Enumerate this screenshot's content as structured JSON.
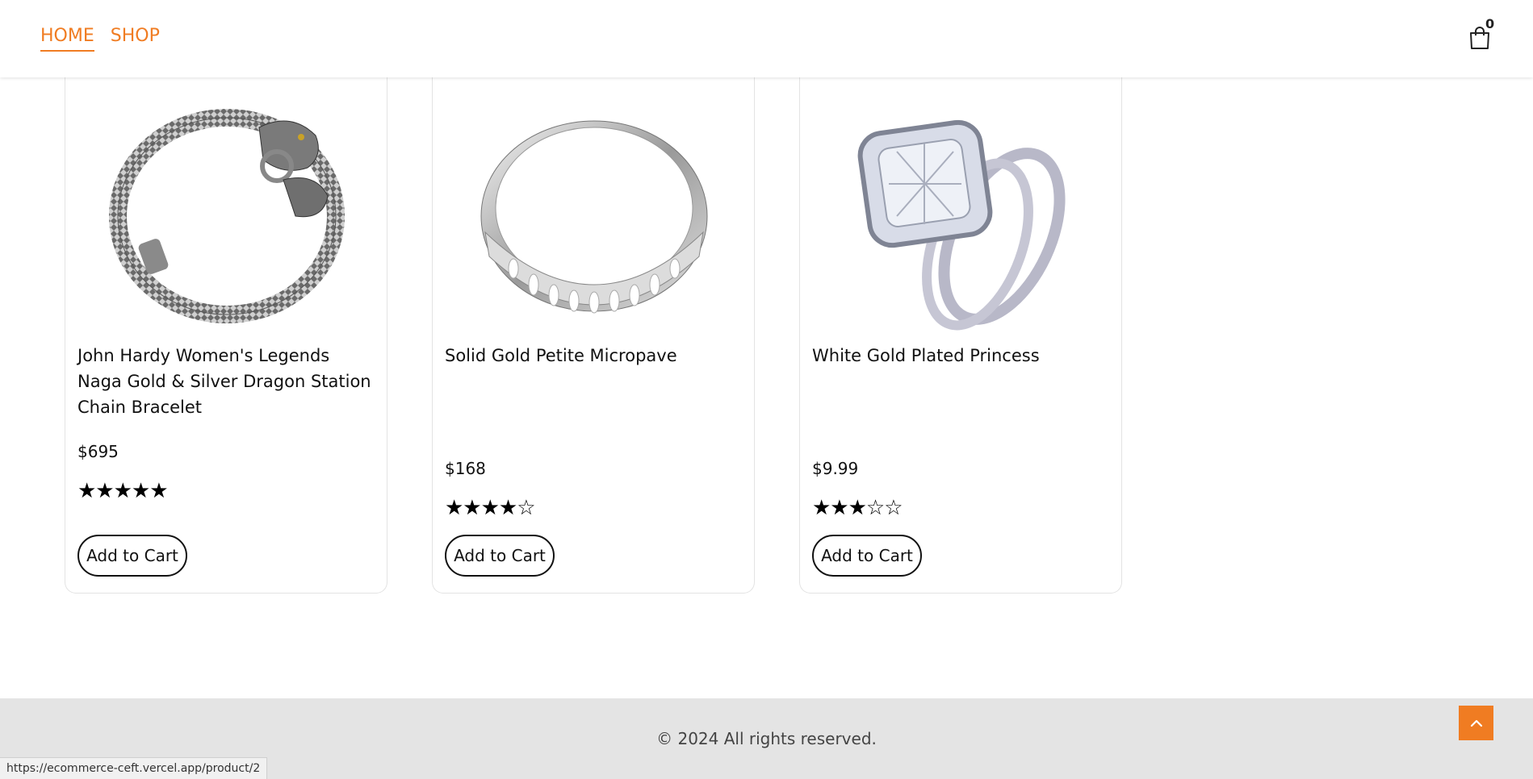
{
  "nav": {
    "items": [
      {
        "label": "HOME",
        "active": true
      },
      {
        "label": "SHOP",
        "active": false
      }
    ]
  },
  "cart": {
    "count": "0",
    "icon": "shopping-bag-icon"
  },
  "products": [
    {
      "title": "John Hardy Women's Legends Naga Gold & Silver Dragon Station Chain Bracelet",
      "price": "$695",
      "rating": 5,
      "stars": "★★★★★",
      "button": "Add to Cart"
    },
    {
      "title": "Solid Gold Petite Micropave",
      "price": "$168",
      "rating": 4,
      "stars": "★★★★☆",
      "button": "Add to Cart"
    },
    {
      "title": "White Gold Plated Princess",
      "price": "$9.99",
      "rating": 3,
      "stars": "★★★☆☆",
      "button": "Add to Cart"
    }
  ],
  "footer": {
    "copyright": "© 2024 All rights reserved."
  },
  "back_to_top": {
    "icon": "chevron-up-icon"
  },
  "status_bar": {
    "url": "https://ecommerce-ceft.vercel.app/product/2"
  },
  "colors": {
    "accent": "#f07c22",
    "footer_bg": "#e4e4e4"
  }
}
